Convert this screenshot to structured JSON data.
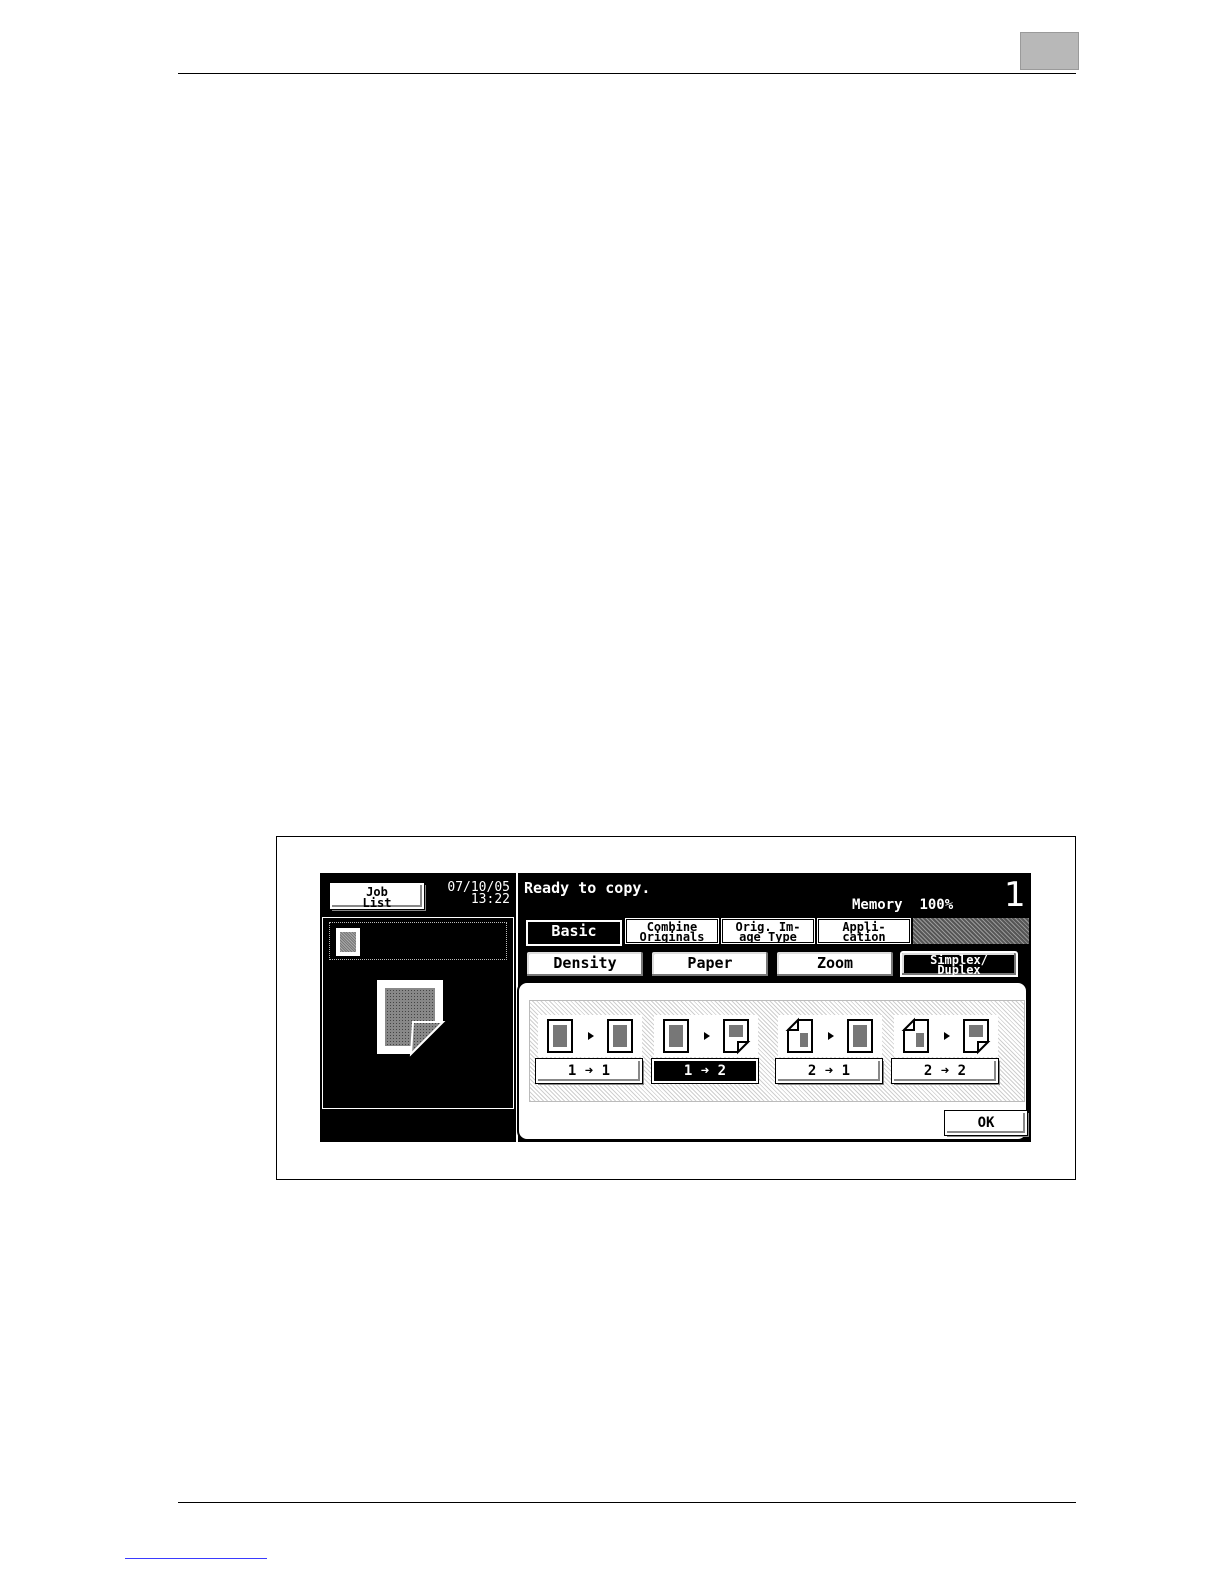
{
  "screen": {
    "job_list_label": "Job\nList",
    "date": "07/10/05",
    "time": "13:22",
    "status_message": "Ready to copy.",
    "memory_label": "Memory",
    "memory_value": "100%",
    "copy_count": "1",
    "tabs": [
      {
        "label": "Basic",
        "selected": true
      },
      {
        "label": "Combine\nOriginals",
        "selected": false
      },
      {
        "label": "Orig. Im-\nage Type",
        "selected": false
      },
      {
        "label": "Appli-\ncation",
        "selected": false
      }
    ],
    "subtabs": [
      {
        "label": "Density",
        "selected": false
      },
      {
        "label": "Paper",
        "selected": false
      },
      {
        "label": "Zoom",
        "selected": false
      },
      {
        "label": "Simplex/\nDuplex",
        "selected": true
      }
    ],
    "duplex_options": [
      {
        "label": "1 ➜ 1",
        "selected": false
      },
      {
        "label": "1 ➜ 2",
        "selected": true
      },
      {
        "label": "2 ➜ 1",
        "selected": false
      },
      {
        "label": "2 ➜ 2",
        "selected": false
      }
    ],
    "ok_label": "OK"
  }
}
